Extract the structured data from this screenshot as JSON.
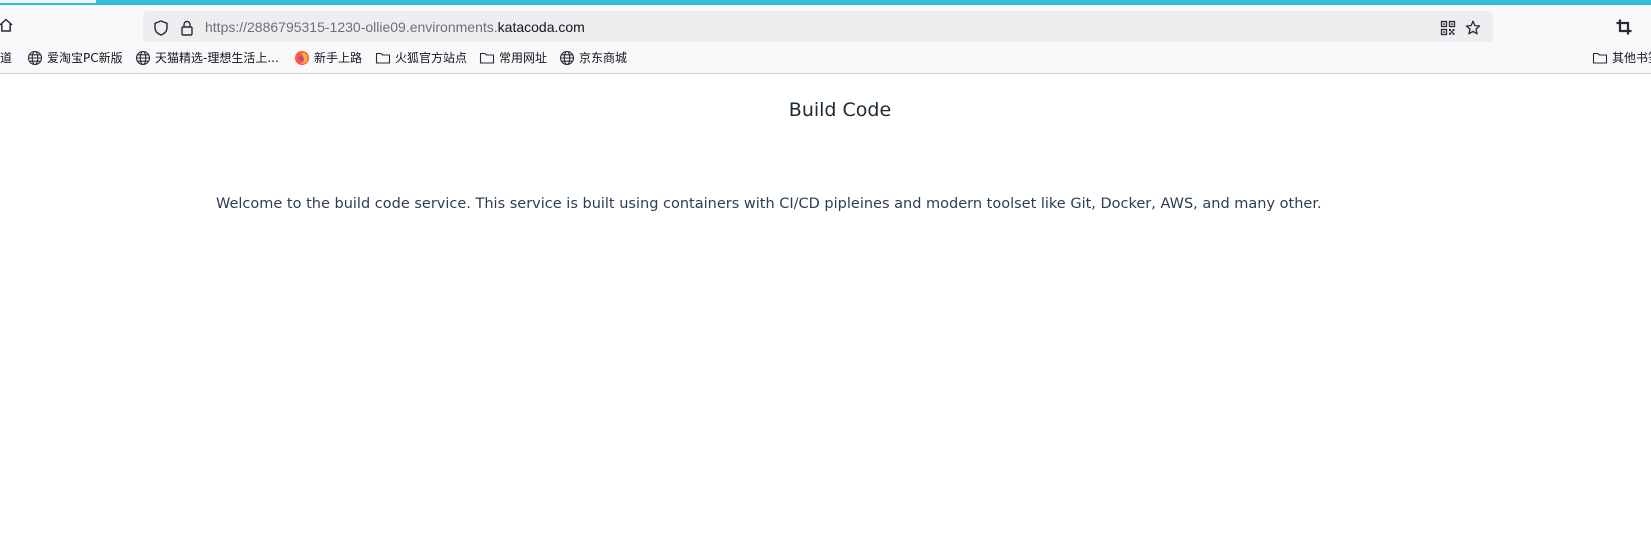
{
  "browser": {
    "url": {
      "prefix": "https://2886795315-1230-ollie09.environments.",
      "host": "katacoda.com"
    },
    "bookmarks": [
      {
        "label": "道",
        "icon": "none"
      },
      {
        "label": "爱淘宝PC新版",
        "icon": "globe-icon"
      },
      {
        "label": "天猫精选-理想生活上...",
        "icon": "globe-icon"
      },
      {
        "label": "新手上路",
        "icon": "firefox-icon"
      },
      {
        "label": "火狐官方站点",
        "icon": "folder-icon"
      },
      {
        "label": "常用网址",
        "icon": "folder-icon"
      },
      {
        "label": "京东商城",
        "icon": "globe-icon"
      },
      {
        "label": "其他书签",
        "icon": "folder-icon"
      }
    ]
  },
  "page": {
    "title": "Build Code",
    "intro": "Welcome to the build code service. This service is built using containers with CI/CD pipleines and modern toolset like Git, Docker, AWS, and many other."
  },
  "colors": {
    "accent_bar": "#35bcd6",
    "toolbar_bg": "#f9f9fb",
    "urlbar_bg": "#eeeef1",
    "title_text": "#1c2a35",
    "body_text": "#2c3e50"
  }
}
